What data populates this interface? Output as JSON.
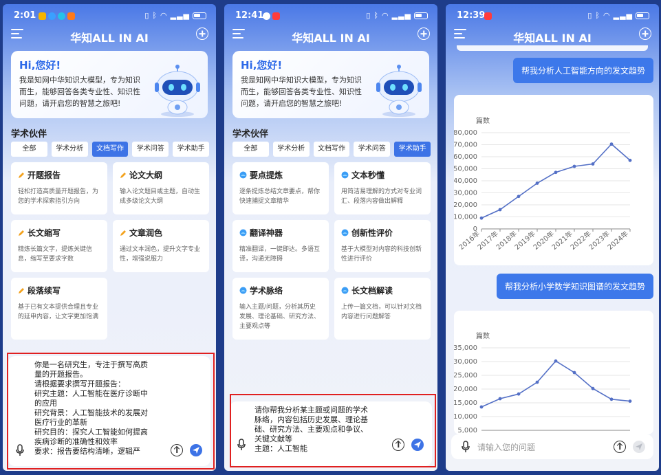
{
  "app": {
    "title": "华知ALL IN AI"
  },
  "phones": [
    {
      "time": "2:01"
    },
    {
      "time": "12:41"
    },
    {
      "time": "12:39"
    }
  ],
  "welcome": {
    "greeting": "Hi,您好!",
    "text": "我是知网中华知识大模型，专为知识 而生，能够回答各类专业性、知识性 问题，请开启您的智慧之旅吧!"
  },
  "section_title": "学术伙伴",
  "tabs": [
    "全部",
    "学术分析",
    "文档写作",
    "学术问答",
    "学术助手"
  ],
  "phone1": {
    "active_tab": 2,
    "cards": [
      {
        "title": "开题报告",
        "desc": "轻松打造高质量开题报告，为您的学术探索指引方向"
      },
      {
        "title": "论文大纲",
        "desc": "输入论文题目或主题，自动生成多级论文大纲"
      },
      {
        "title": "长文缩写",
        "desc": "精炼长篇文字，提炼关键信息，缩写至要求字数"
      },
      {
        "title": "文章润色",
        "desc": "通过文本润色，提升文字专业性，增强说服力"
      },
      {
        "title": "段落续写",
        "desc": "基于已有文本提供合理且专业的延申内容，让文字更加饱满"
      }
    ],
    "prompt": "你是一名研究生，专注于撰写高质\n量的开题报告。\n请根据要求撰写开题报告：\n研究主题：人工智能在医疗诊断中\n的应用\n研究背景：人工智能技术的发展对\n医疗行业的革新\n研究目的：探究人工智能如何提高\n疾病诊断的准确性和效率\n要求：报告要结构清晰，逻辑严"
  },
  "phone2": {
    "active_tab": 4,
    "cards": [
      {
        "title": "要点提炼",
        "desc": "逐条提炼总结文章要点，帮你快速捕捉文章精华"
      },
      {
        "title": "文本秒懂",
        "desc": "用简洁易理解的方式对专业词汇、段落内容做出解释"
      },
      {
        "title": "翻译神器",
        "desc": "精准翻译，一键即达。多语互译，沟通无障碍"
      },
      {
        "title": "创新性评价",
        "desc": "基于大模型对内容的科技创新性进行评价"
      },
      {
        "title": "学术脉络",
        "desc": "输入主题/问题，分析其历史发展、理论基础、研究方法、主要观点等"
      },
      {
        "title": "长文档解读",
        "desc": "上传一篇文档，可以针对文档内容进行问题解答"
      }
    ],
    "prompt": "请你帮我分析某主题或问题的学术\n脉络，内容包括历史发展、理论基\n础、研究方法、主要观点和争议、\n关键文献等\n主题：人工智能"
  },
  "phone3": {
    "bubble1": "帮我分析人工智能方向的发文趋势",
    "bubble2": "帮我分析小学数学知识图谱的发文趋势",
    "input_placeholder": "请输入您的问题"
  },
  "chart_data": [
    {
      "type": "line",
      "ylabel": "篇数",
      "x": [
        "2016年",
        "2017年",
        "2018年",
        "2019年",
        "2020年",
        "2021年",
        "2022年",
        "2023年",
        "2024年"
      ],
      "values": [
        9000,
        16000,
        27000,
        38000,
        47000,
        52000,
        54000,
        70500,
        57000
      ],
      "ylim": [
        0,
        80000
      ],
      "yticks": [
        "0",
        "10,000",
        "20,000",
        "30,000",
        "40,000",
        "50,000",
        "60,000",
        "70,000",
        "80,000"
      ],
      "color": "#5470c6",
      "grid": true
    },
    {
      "type": "line",
      "ylabel": "篇数",
      "values": [
        13500,
        16500,
        18200,
        22500,
        30200,
        26000,
        20200,
        16300,
        15600
      ],
      "ylim": [
        5000,
        35000
      ],
      "yticks": [
        "5,000",
        "10,000",
        "15,000",
        "20,000",
        "25,000",
        "30,000",
        "35,000"
      ],
      "color": "#5470c6",
      "grid": true
    }
  ]
}
